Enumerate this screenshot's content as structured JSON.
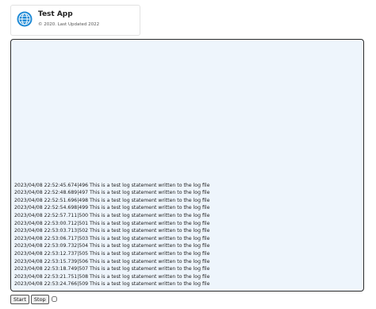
{
  "header": {
    "title": "Test App",
    "subtitle": "© 2020. Last Updated 2022",
    "icon": "globe-icon",
    "icon_color": "#1e8ad6"
  },
  "log": {
    "background": "#eef5fc",
    "lines": [
      "2023/04/08 22:52:45.674|496 This is a test log statement written to the log file",
      "2023/04/08 22:52:48.689|497 This is a test log statement written to the log file",
      "2023/04/08 22:52:51.696|498 This is a test log statement written to the log file",
      "2023/04/08 22:52:54.698|499 This is a test log statement written to the log file",
      "2023/04/08 22:52:57.711|500 This is a test log statement written to the log file",
      "2023/04/08 22:53:00.712|501 This is a test log statement written to the log file",
      "2023/04/08 22:53:03.713|502 This is a test log statement written to the log file",
      "2023/04/08 22:53:06.717|503 This is a test log statement written to the log file",
      "2023/04/08 22:53:09.732|504 This is a test log statement written to the log file",
      "2023/04/08 22:53:12.737|505 This is a test log statement written to the log file",
      "2023/04/08 22:53:15.739|506 This is a test log statement written to the log file",
      "2023/04/08 22:53:18.749|507 This is a test log statement written to the log file",
      "2023/04/08 22:53:21.751|508 This is a test log statement written to the log file",
      "2023/04/08 22:53:24.766|509 This is a test log statement written to the log file"
    ]
  },
  "controls": {
    "start_label": "Start",
    "stop_label": "Stop",
    "checkbox_checked": false
  }
}
